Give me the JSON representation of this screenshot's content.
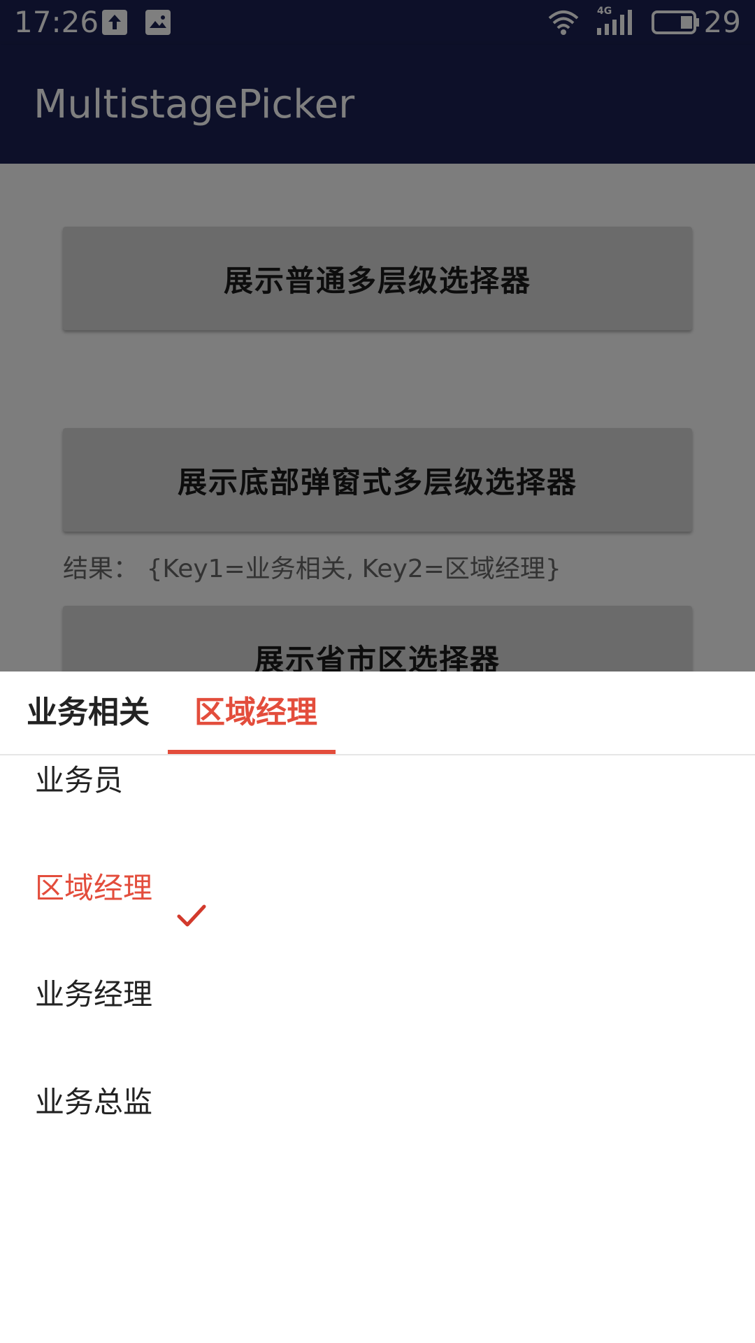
{
  "status_bar": {
    "time": "17:26",
    "network_label": "4G",
    "battery_level": "29",
    "icons": [
      "upload-icon",
      "image-icon",
      "wifi-icon",
      "signal-icon",
      "battery-icon"
    ]
  },
  "app_bar": {
    "title": "MultistagePicker"
  },
  "content": {
    "button_normal_picker": "展示普通多层级选择器",
    "button_bottom_picker": "展示底部弹窗式多层级选择器",
    "result_label": "结果：",
    "result_value": "{Key1=业务相关, Key2=区域经理}",
    "button_region_picker": "展示省市区选择器"
  },
  "sheet": {
    "tabs": [
      {
        "label": "业务相关",
        "active": false
      },
      {
        "label": "区域经理",
        "active": true
      }
    ],
    "options": [
      {
        "label": "业务员",
        "selected": false
      },
      {
        "label": "区域经理",
        "selected": true
      },
      {
        "label": "业务经理",
        "selected": false
      },
      {
        "label": "业务总监",
        "selected": false
      }
    ]
  },
  "colors": {
    "primary": "#1b2152",
    "accent": "#e34d3c",
    "button_bg": "#d6d6d6"
  }
}
